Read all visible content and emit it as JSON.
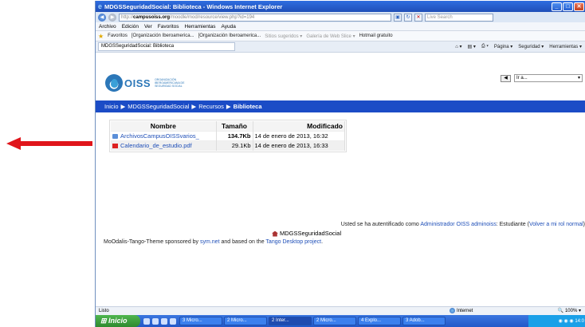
{
  "browser": {
    "title": "MDGSSeguridadSocial: Biblioteca - Windows Internet Explorer",
    "address_host": "campusoiss.org",
    "address_prefix": "http://",
    "address_path": "/moodle/mod/resource/view.php?id=194",
    "search_placeholder": "Live Search",
    "menu": [
      "Archivo",
      "Edición",
      "Ver",
      "Favoritos",
      "Herramientas",
      "Ayuda"
    ],
    "favorites_label": "Favoritos",
    "favorites": [
      "[Organización Iberoamerica...",
      "[Organización Iberoamerica...",
      "Sitios sugeridos ▾",
      "Galería de Web Slice ▾",
      "Hotmail gratuito"
    ],
    "tab_title": "MDGSSeguridadSocial: Biblioteca",
    "commands": [
      "Página ▾",
      "Seguridad ▾",
      "Herramientas ▾"
    ]
  },
  "page": {
    "logo_text": "OISS",
    "logo_subtext": "ORGANIZACIÓN IBEROAMERICANA DE SEGURIDAD SOCIAL",
    "lang_value": "Ir a...",
    "breadcrumb": {
      "home": "Inicio",
      "course": "MDGSSeguridadSocial",
      "resources": "Recursos",
      "current": "Biblioteca",
      "sep": "▶"
    },
    "files": {
      "headers": {
        "name": "Nombre",
        "size": "Tamaño",
        "modified": "Modificado"
      },
      "rows": [
        {
          "icon": "folder-icon",
          "name": "ArchivosCampusOISSvarios_",
          "size": "134.7Kb",
          "modified": "14 de enero de 2013, 16:32"
        },
        {
          "icon": "pdf-icon",
          "name": "Calendario_de_estudio.pdf",
          "size": "29.1Kb",
          "modified": "14 de enero de 2013, 16:33"
        }
      ]
    },
    "footer": {
      "auth_prefix": "Usted se ha autentificado como",
      "auth_user": "Administrador OISS adminoiss",
      "auth_role": ": Estudiante (",
      "auth_link": "Volver a mi rol normal",
      "auth_suffix": ")",
      "home_link": "MDGSSeguridadSocial",
      "theme_prefix": "MoOdalis-Tango-Theme sponsored by",
      "theme_link1": "sym.net",
      "theme_middle": "and based on the",
      "theme_link2": "Tango Desktop project",
      "theme_suffix": "."
    }
  },
  "status": {
    "left": "Listo",
    "zone": "Internet",
    "zoom": "100%"
  },
  "taskbar": {
    "start": "Inicio",
    "items": [
      "3 Micro...",
      "2 Micro...",
      "2 Inter...",
      "2 Micro...",
      "4 Explo...",
      "3 Adob..."
    ],
    "clock": "14:0"
  },
  "colors": {
    "arrow": "#e0151b",
    "navbar": "#1b4cc6",
    "link": "#1f4fb8"
  }
}
